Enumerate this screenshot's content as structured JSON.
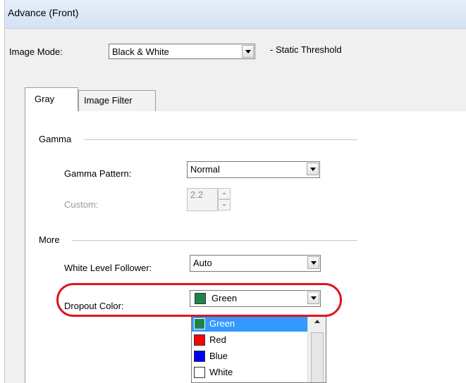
{
  "window": {
    "title": "Advance (Front)"
  },
  "image_mode": {
    "label": "Image Mode:",
    "value": "Black & White",
    "note": "- Static Threshold"
  },
  "tabs": [
    {
      "label": "Gray"
    },
    {
      "label": "Image Filter"
    }
  ],
  "gamma_group": {
    "title": "Gamma",
    "pattern_label": "Gamma Pattern:",
    "pattern_value": "Normal",
    "custom_label": "Custom:",
    "custom_value": "2.2"
  },
  "more_group": {
    "title": "More",
    "white_level_label": "White Level Follower:",
    "white_level_value": "Auto",
    "dropout_label": "Dropout Color:",
    "dropout_value": "Green",
    "dropout_color": "#1e8449"
  },
  "dropout_options": [
    {
      "label": "Green",
      "color": "#1e8449",
      "selected": true
    },
    {
      "label": "Red",
      "color": "#ff0000",
      "selected": false
    },
    {
      "label": "Blue",
      "color": "#0000ff",
      "selected": false
    },
    {
      "label": "White",
      "color": "#ffffff",
      "selected": false
    }
  ],
  "colors": {
    "highlight_ring": "#e2141c",
    "selection": "#3399ff"
  }
}
